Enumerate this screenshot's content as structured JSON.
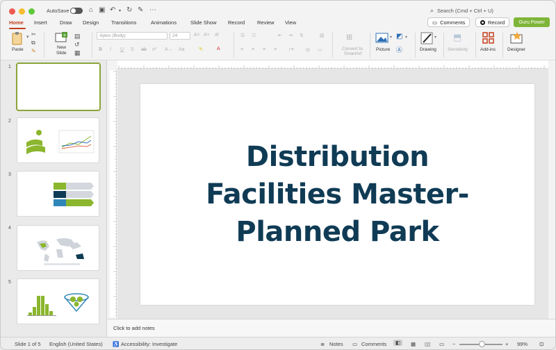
{
  "titlebar": {
    "autosave_label": "AutoSave",
    "search_placeholder": "Search (Cmd + Ctrl + U)"
  },
  "menu": {
    "tabs": [
      "Home",
      "Insert",
      "Draw",
      "Design",
      "Transitions",
      "Animations",
      "Slide Show",
      "Record",
      "Review",
      "View"
    ],
    "active_tab": "Home",
    "comments_label": "Comments",
    "record_label": "Record",
    "guru_label": "Guru Power"
  },
  "ribbon": {
    "paste_label": "Paste",
    "new_slide_label_1": "New",
    "new_slide_label_2": "Slide",
    "font_name_placeholder": "Aptos (Body)",
    "font_size_placeholder": "24",
    "convert_label_1": "Convert to",
    "convert_label_2": "SmartArt",
    "picture_label": "Picture",
    "drawing_label": "Drawing",
    "sensitivity_label": "Sensitivity",
    "addins_label": "Add-ins",
    "designer_label": "Designer"
  },
  "thumbnails": {
    "numbers": [
      "1",
      "2",
      "3",
      "4",
      "5"
    ],
    "selected": "1"
  },
  "slide": {
    "title": "Distribution Facilities Master-Planned Park"
  },
  "notes": {
    "placeholder": "Click to add notes"
  },
  "status": {
    "slide_indicator": "Slide 1 of 5",
    "language": "English (United States)",
    "accessibility": "Accessibility: Investigate",
    "notes_label": "Notes",
    "comments_label": "Comments",
    "zoom": "99%"
  },
  "colors": {
    "accent": "#c43e1c",
    "guru": "#7fb539",
    "title": "#103b55",
    "thumb_selected": "#8ca43a"
  }
}
